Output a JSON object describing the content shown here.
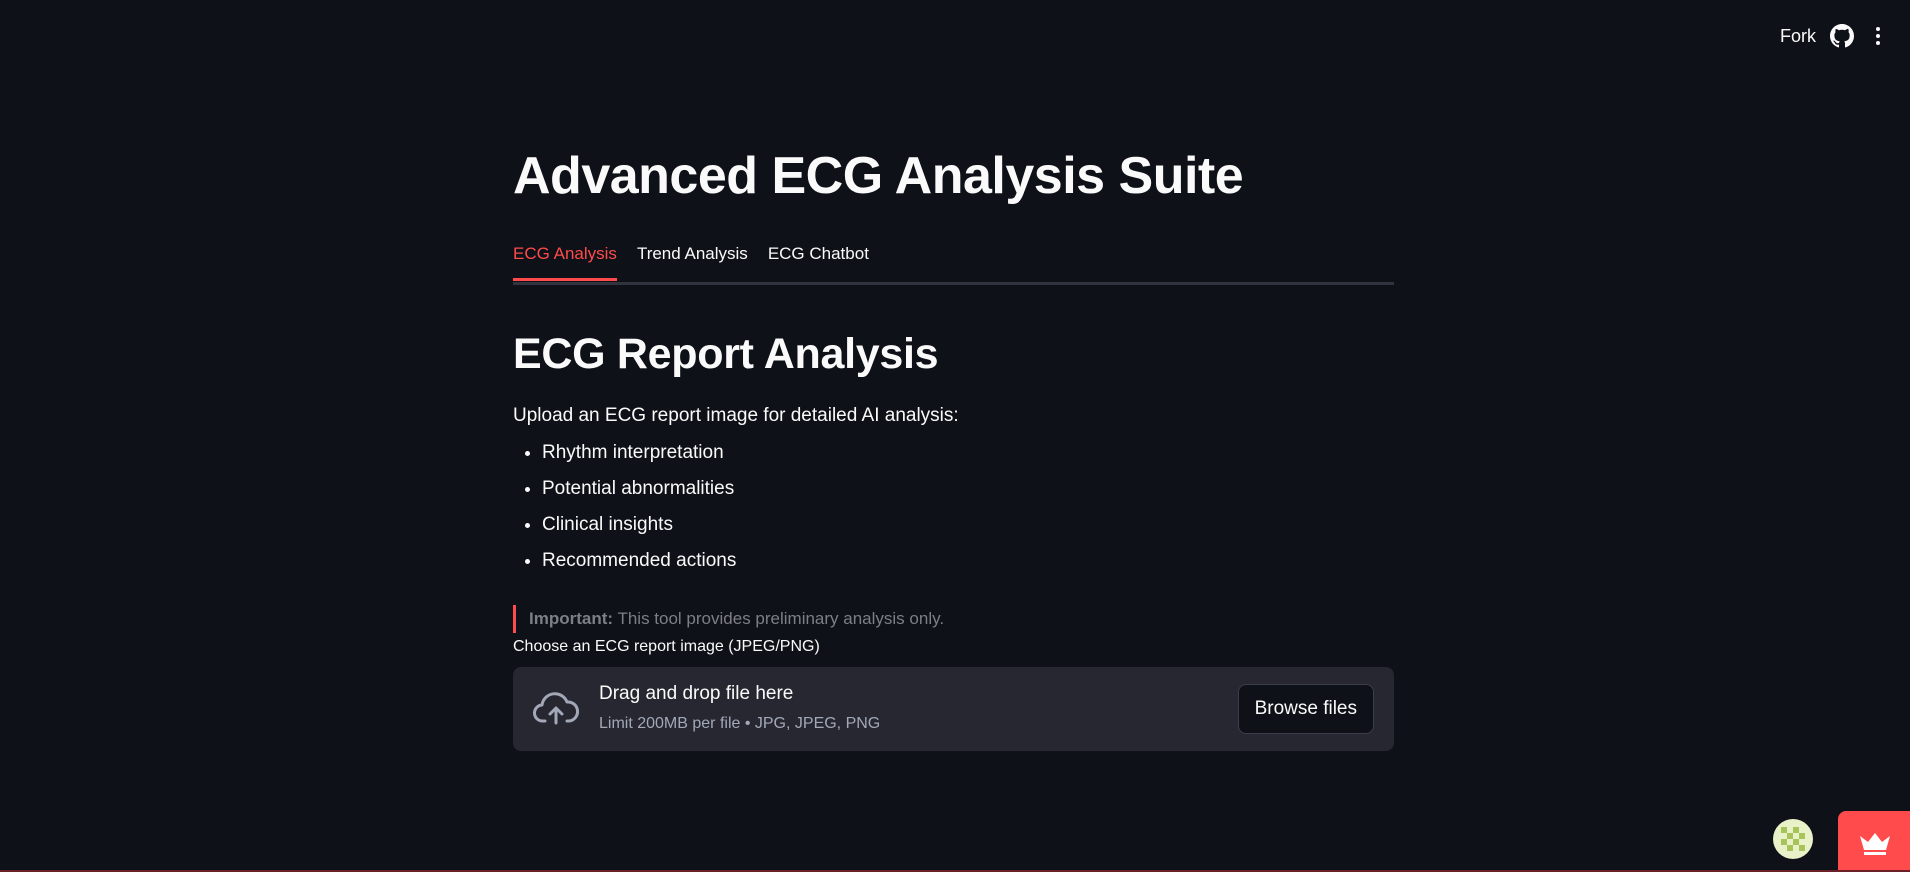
{
  "header": {
    "fork_label": "Fork",
    "github_icon": "github-icon",
    "menu_icon": "kebab-menu-icon"
  },
  "app": {
    "title": "Advanced ECG Analysis Suite",
    "tabs": [
      {
        "label": "ECG Analysis",
        "active": true
      },
      {
        "label": "Trend Analysis",
        "active": false
      },
      {
        "label": "ECG Chatbot",
        "active": false
      }
    ]
  },
  "section": {
    "title": "ECG Report Analysis",
    "intro": "Upload an ECG report image for detailed AI analysis:",
    "bullets": [
      "Rhythm interpretation",
      "Potential abnormalities",
      "Clinical insights",
      "Recommended actions"
    ],
    "callout_bold": "Important:",
    "callout_text": " This tool provides preliminary analysis only."
  },
  "uploader": {
    "label": "Choose an ECG report image (JPEG/PNG)",
    "drop_text": "Drag and drop file here",
    "limit_text": "Limit 200MB per file • JPG, JPEG, PNG",
    "browse_label": "Browse files",
    "icon": "cloud-upload-icon"
  },
  "colors": {
    "background": "#0e1117",
    "accent": "#ff4b4b",
    "panel": "#262730"
  }
}
